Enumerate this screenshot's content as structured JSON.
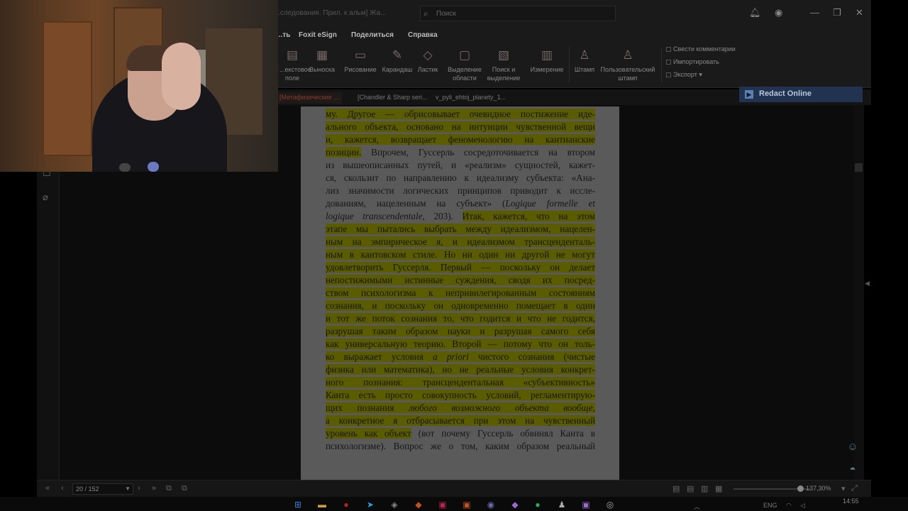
{
  "window": {
    "title": "[Метафизическ...] ...следования. Прил. к альм] Жа...",
    "search_placeholder": "Поиск"
  },
  "menu": [
    {
      "label": "...ть",
      "x": 0
    },
    {
      "label": "Foxit eSign"
    },
    {
      "label": "Поделиться"
    },
    {
      "label": "Справка"
    }
  ],
  "ribbon": {
    "buttons": [
      {
        "label": "...екстовое\nполе",
        "icon": "text-field-icon"
      },
      {
        "label": "Выноска",
        "icon": "callout-icon"
      },
      {
        "label": "Рисование",
        "icon": "shape-icon"
      },
      {
        "label": "Карандаш",
        "icon": "pencil-icon"
      },
      {
        "label": "Ластик",
        "icon": "eraser-icon"
      },
      {
        "label": "Выделение\nобласти",
        "icon": "area-highlight-icon"
      },
      {
        "label": "Поиск и\nвыделение",
        "icon": "search-highlight-icon"
      },
      {
        "label": "Измерение",
        "icon": "ruler-icon"
      },
      {
        "label": "Штамп",
        "icon": "stamp-icon"
      },
      {
        "label": "Пользовательский\nштамп",
        "icon": "custom-stamp-icon"
      }
    ],
    "side_actions": [
      {
        "label": "Свести комментарии"
      },
      {
        "label": "Импортировать"
      },
      {
        "label": "Экспорт"
      }
    ]
  },
  "doc_tabs": [
    {
      "label": "[Метафизические ...",
      "active": true
    },
    {
      "label": "[Chandler & Sharp seri..."
    },
    {
      "label": "v_pyli_ehtoj_planety_1..."
    }
  ],
  "redact_label": "Redact Online",
  "document_lines": [
    [
      {
        "t": "му. Другое — обрисовывает очевидное постижение иде-",
        "h": true
      }
    ],
    [
      {
        "t": "ального объекта, основано на интуиции чувственной вещи",
        "h": true
      }
    ],
    [
      {
        "t": "и, кажется, возвращает феноменологию на кантианские",
        "h": true
      }
    ],
    [
      {
        "t": "позиции.",
        "h": true
      },
      {
        "t": " Впрочем, Гуссерль сосредоточивается на втором",
        "h": false
      }
    ],
    [
      {
        "t": "из вышеописанных путей, и «реализм» сущностей, кажет-",
        "h": false
      }
    ],
    [
      {
        "t": "ся, скользит по направлению к идеализму субъекта: «Ана-",
        "h": false
      }
    ],
    [
      {
        "t": "лиз значимости логических принципов приводит к иссле-",
        "h": false
      }
    ],
    [
      {
        "t": "дованиям, нацеленным на субъект» (",
        "h": false
      },
      {
        "t": "Logique formelle et",
        "h": false,
        "i": true
      }
    ],
    [
      {
        "t": "logique transcendentale",
        "h": false,
        "i": true
      },
      {
        "t": ", 203). ",
        "h": false
      },
      {
        "t": "Итак, кажется, что на этом",
        "h": true
      }
    ],
    [
      {
        "t": "этапе мы пытались выбрать между идеализмом, нацелен-",
        "h": true
      }
    ],
    [
      {
        "t": "ным на эмпирическое я, и идеализмом трансценденталь-",
        "h": true
      }
    ],
    [
      {
        "t": "ным в кантовском стиле. Но ни один ни другой не могут",
        "h": true
      }
    ],
    [
      {
        "t": "удовлетворить Гуссерля. Первый — поскольку он делает",
        "h": true
      }
    ],
    [
      {
        "t": "непостижимыми истинные суждения, сводя их посред-",
        "h": true
      }
    ],
    [
      {
        "t": "ством психологизма к непривилегированным состояниям",
        "h": true
      }
    ],
    [
      {
        "t": "сознания, и поскольку он одновременно помещает в один",
        "h": true
      }
    ],
    [
      {
        "t": "и тот же поток сознания то, что годится и что не годится,",
        "h": true
      }
    ],
    [
      {
        "t": "разрушая таким образом науки и разрушая самого себя",
        "h": true
      }
    ],
    [
      {
        "t": "как универсальную теорию. Второй — потому что он толь-",
        "h": true
      }
    ],
    [
      {
        "t": "ко выражает условия ",
        "h": true
      },
      {
        "t": "a priori",
        "h": true,
        "i": true
      },
      {
        "t": " чистого сознания (чистые",
        "h": true
      }
    ],
    [
      {
        "t": "физика или математика), но не реальные условия конкрет-",
        "h": true
      }
    ],
    [
      {
        "t": "ного познания: трансцендентальная «субъективность»",
        "h": true
      }
    ],
    [
      {
        "t": "Канта есть просто совокупность условий, регламентирую-",
        "h": true
      }
    ],
    [
      {
        "t": "щих познания ",
        "h": true
      },
      {
        "t": "любого возможного объекта вообще",
        "h": true,
        "i": true
      },
      {
        "t": ",",
        "h": true
      }
    ],
    [
      {
        "t": "а конкретное я отбрасывается при этом на чувственный",
        "h": true
      }
    ],
    [
      {
        "t": "уровень как объект",
        "h": true
      },
      {
        "t": " (вот почему Гуссерль обвинял Канта в",
        "h": false
      }
    ],
    [
      {
        "t": "психологизме). Вопрос же о том, каким образом реальный",
        "h": false
      }
    ]
  ],
  "status": {
    "page_indicator": "20 / 152",
    "zoom": "137,30%",
    "zoom_fraction": 0.87
  },
  "taskbar": {
    "lang": "ENG",
    "time": "14:55"
  }
}
